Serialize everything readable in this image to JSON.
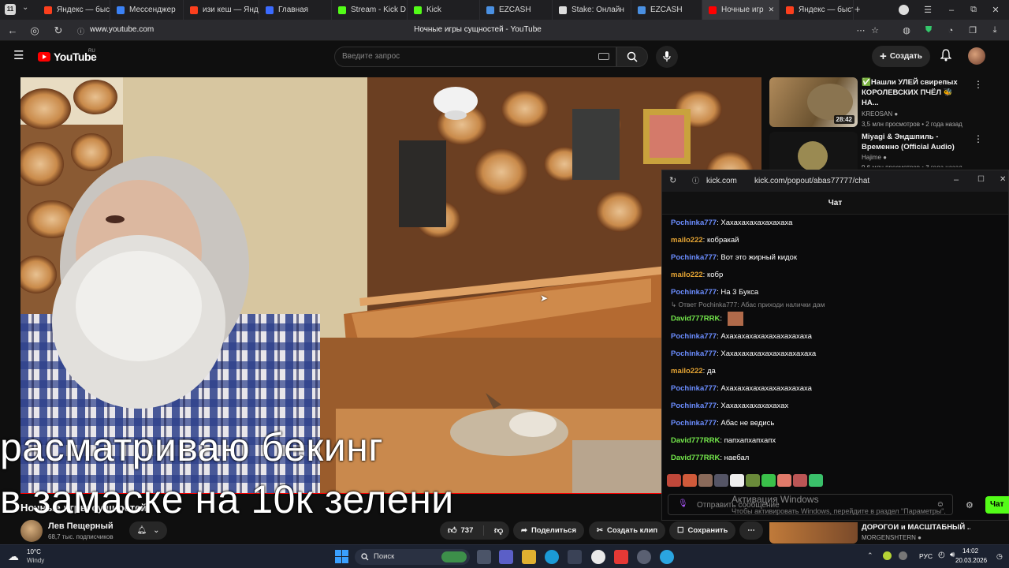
{
  "browser": {
    "tabs": [
      {
        "label": "Яндекс — быст",
        "color": "#fc3f1d"
      },
      {
        "label": "Мессенджер",
        "color": "#3b82f6"
      },
      {
        "label": "изи кеш — Янд",
        "color": "#fc3f1d"
      },
      {
        "label": "Главная",
        "color": "#3b6bff"
      },
      {
        "label": "Stream - Kick D",
        "color": "#53fc18"
      },
      {
        "label": "Kick",
        "color": "#53fc18"
      },
      {
        "label": "EZCASH",
        "color": "#4a90e2"
      },
      {
        "label": "Stake: Онлайн",
        "color": "#dcdcdc"
      },
      {
        "label": "EZCASH",
        "color": "#4a90e2"
      },
      {
        "label": "Ночные игр",
        "color": "#ff0000"
      },
      {
        "label": "Яндекс — быст",
        "color": "#fc3f1d"
      }
    ],
    "url": "www.youtube.com",
    "page_title": "Ночные игры сущностей - YouTube"
  },
  "youtube": {
    "logo_text": "YouTube",
    "region": "RU",
    "search_placeholder": "Введите запрос",
    "create_label": "Создать",
    "channel_name": "Лев Пещерный",
    "subscribers": "68,7 тыс. подписчиков",
    "video_title_overlay": "Ночные игры сущностей",
    "like_count": "737",
    "share_label": "Поделиться",
    "clip_label": "Создать клип",
    "save_label": "Сохранить"
  },
  "recommendations": [
    {
      "title": "✅Нашли УЛЕЙ свирепых КОРОЛЕВСКИХ ПЧЁЛ 🐝 НА...",
      "channel": "KREOSAN",
      "meta": "3,5 млн просмотров • 2 года назад",
      "duration": "28:42"
    },
    {
      "title": "Miyagi & Эндшпиль - Временно (Official Audio)",
      "channel": "Hajime",
      "meta": "9,6 млн просмотров • 3 года назад",
      "duration": ""
    },
    {
      "title": "ДОРОГОИ и МАСШТАБНЫЙ ...",
      "channel": "MORGENSHTERN",
      "meta": "",
      "duration": ""
    }
  ],
  "kick": {
    "domain": "kick.com",
    "url": "kick.com/popout/abas77777/chat",
    "chat_title": "Чат",
    "messages": [
      {
        "user": "Pochinka777",
        "cls": "u-poch",
        "text": "Хахахахахахахахаха"
      },
      {
        "user": "mailo222",
        "cls": "u-mail",
        "text": "кобракай"
      },
      {
        "user": "Pochinka777",
        "cls": "u-poch",
        "text": "Вот это жирный кидок"
      },
      {
        "user": "mailo222",
        "cls": "u-mail",
        "text": "кобр"
      },
      {
        "user": "Pochinka777",
        "cls": "u-poch",
        "text": "На 3 Букса"
      },
      {
        "user": "David777RRK",
        "cls": "u-dav",
        "text": ""
      },
      {
        "user": "Pochinka777",
        "cls": "u-poch",
        "text": "Ахахахахахахахахахахаха"
      },
      {
        "user": "Pochinka777",
        "cls": "u-poch",
        "text": "Хахахахахахахахахахахаха"
      },
      {
        "user": "mailo222",
        "cls": "u-mail",
        "text": "да"
      },
      {
        "user": "Pochinka777",
        "cls": "u-poch",
        "text": "Ахахахахахахахахахахаха"
      },
      {
        "user": "Pochinka777",
        "cls": "u-poch",
        "text": "Хахахахахахахахах"
      },
      {
        "user": "Pochinka777",
        "cls": "u-poch",
        "text": "Абас не ведись"
      },
      {
        "user": "David777RRK",
        "cls": "u-dav",
        "text": "папхапхапхапх"
      },
      {
        "user": "David777RRK",
        "cls": "u-dav",
        "text": "наебал"
      }
    ],
    "reply_hint": "↳ Ответ Pochinka777: Абас приходи налички дам",
    "input_placeholder": "Отправить сообщение",
    "chat_button": "Чат"
  },
  "captions": {
    "line1": "расматриваю бекинг",
    "line2": "в замаске  на 10к зелени"
  },
  "windows": {
    "activate_title": "Активация Windows",
    "activate_text": "Чтобы активировать Windows, перейдите в раздел \"Параметры\".",
    "weather_temp": "10°C",
    "weather_desc": "Windy",
    "search_label": "Поиск",
    "lang": "РУС",
    "time": "14:02",
    "date": "20.03.2026"
  }
}
